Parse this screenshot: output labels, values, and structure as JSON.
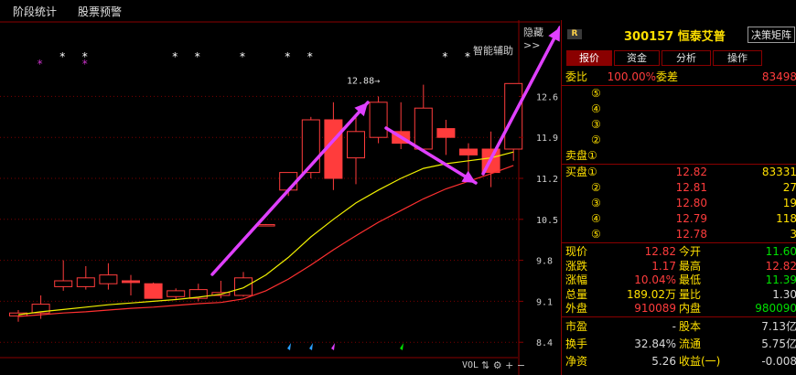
{
  "topbar": {
    "items": [
      "阶段统计",
      "股票预警"
    ]
  },
  "chart": {
    "hide_label": "隐藏>>",
    "smart_label": "智能辅助",
    "vol_label": "VOL",
    "y_ticks": [
      "12.6",
      "11.9",
      "11.2",
      "10.5",
      "9.8",
      "9.1",
      "8.4"
    ],
    "high_marker": "12.88→"
  },
  "stock": {
    "badge": "R",
    "title": "300157 恒泰艾普",
    "decision_button": "决策矩阵"
  },
  "tabs": [
    "报价",
    "资金",
    "分析",
    "操作"
  ],
  "orderbook": {
    "ratio_label": "委比",
    "ratio_value": "100.00%",
    "diff_label": "委差",
    "diff_value": "83498",
    "sell": [
      {
        "label": "⑤",
        "price": "",
        "vol": ""
      },
      {
        "label": "④",
        "price": "",
        "vol": ""
      },
      {
        "label": "③",
        "price": "",
        "vol": ""
      },
      {
        "label": "②",
        "price": "",
        "vol": ""
      },
      {
        "label": "卖盘①",
        "price": "",
        "vol": ""
      }
    ],
    "buy": [
      {
        "label": "买盘①",
        "price": "12.82",
        "vol": "83331"
      },
      {
        "label": "②",
        "price": "12.81",
        "vol": "27"
      },
      {
        "label": "③",
        "price": "12.80",
        "vol": "19"
      },
      {
        "label": "④",
        "price": "12.79",
        "vol": "118"
      },
      {
        "label": "⑤",
        "price": "12.78",
        "vol": "3"
      }
    ]
  },
  "quote": [
    {
      "l1": "现价",
      "v1": "12.82",
      "l2": "今开",
      "v2": "11.60"
    },
    {
      "l1": "涨跌",
      "v1": "1.17",
      "l2": "最高",
      "v2": "12.82"
    },
    {
      "l1": "涨幅",
      "v1": "10.04%",
      "l2": "最低",
      "v2": "11.39"
    },
    {
      "l1": "总量",
      "v1": "189.02万",
      "l2": "量比",
      "v2": "1.30"
    },
    {
      "l1": "外盘",
      "v1": "910089",
      "l2": "内盘",
      "v2": "980090"
    }
  ],
  "stats": [
    {
      "l1": "市盈",
      "v1": "-",
      "l2": "股本",
      "v2": "7.13亿"
    },
    {
      "l1": "换手",
      "v1": "32.84%",
      "l2": "流通",
      "v2": "5.75亿"
    },
    {
      "l1": "净资",
      "v1": "5.26",
      "l2": "收益(一)",
      "v2": "-0.008"
    }
  ],
  "colors": {
    "up": "#ff3c3c",
    "down": "#00e000",
    "label": "#ffe000",
    "ma5": "#f0f000",
    "ma10": "#ff3030",
    "arrow": "#e040ff",
    "star": "#ffffff",
    "star_mark": "#cc33cc"
  },
  "chart_data": {
    "type": "candlestick",
    "ylim": [
      8.2,
      13.2
    ],
    "candles": [
      {
        "o": 8.85,
        "h": 8.95,
        "l": 8.75,
        "c": 8.9
      },
      {
        "o": 8.9,
        "h": 9.2,
        "l": 8.8,
        "c": 9.05
      },
      {
        "o": 9.35,
        "h": 9.8,
        "l": 9.28,
        "c": 9.45
      },
      {
        "o": 9.35,
        "h": 9.7,
        "l": 9.3,
        "c": 9.5
      },
      {
        "o": 9.4,
        "h": 9.75,
        "l": 9.3,
        "c": 9.55
      },
      {
        "o": 9.45,
        "h": 9.55,
        "l": 9.2,
        "c": 9.42
      },
      {
        "o": 9.4,
        "h": 9.42,
        "l": 9.15,
        "c": 9.15
      },
      {
        "o": 9.18,
        "h": 9.32,
        "l": 9.12,
        "c": 9.28
      },
      {
        "o": 9.15,
        "h": 9.4,
        "l": 9.1,
        "c": 9.3
      },
      {
        "o": 9.2,
        "h": 9.45,
        "l": 9.15,
        "c": 9.25
      },
      {
        "o": 9.2,
        "h": 9.6,
        "l": 9.18,
        "c": 9.5
      },
      {
        "o": 10.4,
        "h": 10.42,
        "l": 10.38,
        "c": 10.41
      },
      {
        "o": 11.0,
        "h": 11.3,
        "l": 10.9,
        "c": 11.3
      },
      {
        "o": 11.3,
        "h": 12.25,
        "l": 11.2,
        "c": 12.2
      },
      {
        "o": 12.2,
        "h": 12.5,
        "l": 11.0,
        "c": 11.2
      },
      {
        "o": 11.55,
        "h": 12.3,
        "l": 11.1,
        "c": 12.0
      },
      {
        "o": 11.9,
        "h": 12.6,
        "l": 11.8,
        "c": 12.5
      },
      {
        "o": 12.0,
        "h": 12.5,
        "l": 11.7,
        "c": 11.8
      },
      {
        "o": 11.7,
        "h": 12.8,
        "l": 11.7,
        "c": 12.4
      },
      {
        "o": 12.05,
        "h": 12.2,
        "l": 11.6,
        "c": 11.9
      },
      {
        "o": 11.7,
        "h": 11.8,
        "l": 11.2,
        "c": 11.6
      },
      {
        "o": 11.7,
        "h": 12.0,
        "l": 11.05,
        "c": 11.3
      },
      {
        "o": 11.7,
        "h": 12.45,
        "l": 11.5,
        "c": 12.82
      }
    ],
    "ma5": [
      8.87,
      8.92,
      8.96,
      9.0,
      9.04,
      9.07,
      9.1,
      9.13,
      9.17,
      9.22,
      9.33,
      9.55,
      9.85,
      10.2,
      10.5,
      10.78,
      11.0,
      11.2,
      11.37,
      11.45,
      11.5,
      11.55,
      11.65
    ],
    "ma10": [
      8.84,
      8.87,
      8.9,
      8.92,
      8.95,
      8.98,
      9.0,
      9.03,
      9.06,
      9.08,
      9.14,
      9.28,
      9.48,
      9.72,
      9.98,
      10.22,
      10.45,
      10.65,
      10.85,
      11.02,
      11.15,
      11.28,
      11.42
    ]
  }
}
